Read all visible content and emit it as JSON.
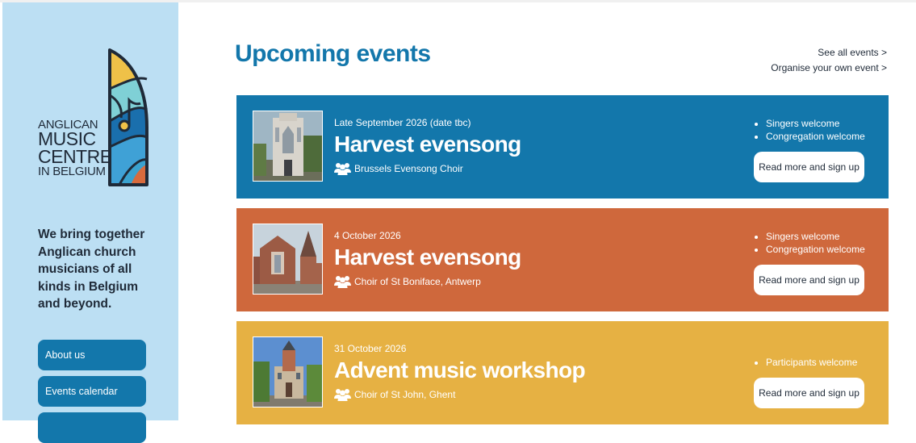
{
  "sidebar": {
    "logo": {
      "line1": "ANGLICAN",
      "line2": "MUSIC",
      "line3": "CENTRE",
      "line4": "IN BELGIUM"
    },
    "tagline": "We bring together Anglican church musicians of all kinds in Belgium and beyond.",
    "nav": [
      {
        "label": "About us"
      },
      {
        "label": "Events calendar"
      },
      {
        "label": ""
      }
    ]
  },
  "main": {
    "heading": "Upcoming events",
    "links": {
      "see_all": "See all events >",
      "organise": "Organise your own event >"
    },
    "events": [
      {
        "date": "Late September 2026 (date tbc)",
        "title": "Harvest evensong",
        "choir": "Brussels Evensong Choir",
        "welcome": [
          "Singers welcome",
          "Congregation welcome"
        ],
        "button": "Read more and sign up",
        "color": "#1377ab"
      },
      {
        "date": "4 October 2026",
        "title": "Harvest evensong",
        "choir": "Choir of St Boniface, Antwerp",
        "welcome": [
          "Singers welcome",
          "Congregation welcome"
        ],
        "button": "Read more and sign up",
        "color": "#cf683c"
      },
      {
        "date": "31 October 2026",
        "title": "Advent music workshop",
        "choir": "Choir of St John, Ghent",
        "welcome": [
          "Participants welcome"
        ],
        "button": "Read more and sign up",
        "color": "#e6b143"
      }
    ]
  },
  "colors": {
    "sidebar_bg": "#bcdff3",
    "accent_blue": "#1377ab",
    "accent_orange": "#cf683c",
    "accent_yellow": "#e6b143",
    "text_dark": "#1f2a38"
  },
  "icons": {
    "choir": "people-group-icon"
  }
}
